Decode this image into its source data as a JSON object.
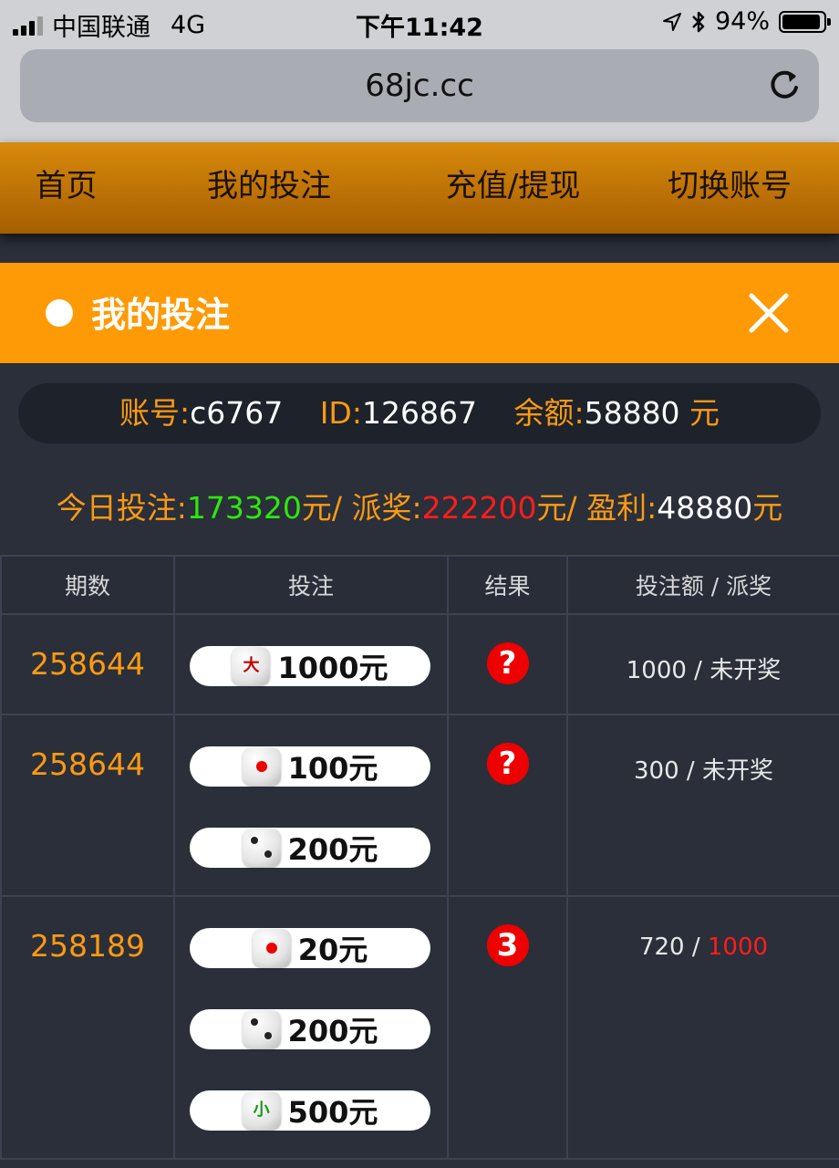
{
  "status": {
    "carrier": "中国联通",
    "network": "4G",
    "time": "下午11:42",
    "battery": "94%"
  },
  "browser": {
    "url": "68jc.cc"
  },
  "nav": {
    "items": [
      "首页",
      "我的投注",
      "充值/提现",
      "切换账号"
    ]
  },
  "panel": {
    "title": "我的投注"
  },
  "account": {
    "account_label": "账号:",
    "account_value": "c6767",
    "id_label": "ID:",
    "id_value": "126867",
    "balance_label": "余额:",
    "balance_value": "58880",
    "balance_unit": " 元"
  },
  "summary": {
    "bet_label": "今日投注:",
    "bet_value": "173320",
    "bet_unit": "元/ ",
    "payout_label": "派奖:",
    "payout_value": "222200",
    "payout_unit": "元/ ",
    "profit_label": "盈利:",
    "profit_value": "48880",
    "profit_unit": "元"
  },
  "table": {
    "headers": [
      "期数",
      "投注",
      "结果",
      "投注额 / 派奖"
    ],
    "rows": [
      {
        "period": "258644",
        "bets": [
          {
            "die": "大",
            "amount": "1000元"
          }
        ],
        "result": "?",
        "bet_total": "1000",
        "sep": " / ",
        "payout": "未开奖"
      },
      {
        "period": "258644",
        "bets": [
          {
            "die": "1",
            "amount": "100元"
          },
          {
            "die": "2",
            "amount": "200元"
          }
        ],
        "result": "?",
        "bet_total": "300",
        "sep": " / ",
        "payout": "未开奖"
      },
      {
        "period": "258189",
        "bets": [
          {
            "die": "1",
            "amount": "20元"
          },
          {
            "die": "2",
            "amount": "200元"
          },
          {
            "die": "小",
            "amount": "500元"
          }
        ],
        "result": "3",
        "bet_total": "720",
        "sep": " / ",
        "payout": "1000"
      }
    ]
  },
  "colors": {
    "orange": "#fe9a06",
    "green": "#2ee80f",
    "red": "#ff1d1d",
    "background": "#2a2f3a"
  },
  "icons": [
    "signal-icon",
    "location-arrow-icon",
    "bluetooth-icon",
    "battery-icon",
    "reload-icon",
    "close-icon",
    "dice-icon",
    "question-badge-icon"
  ]
}
